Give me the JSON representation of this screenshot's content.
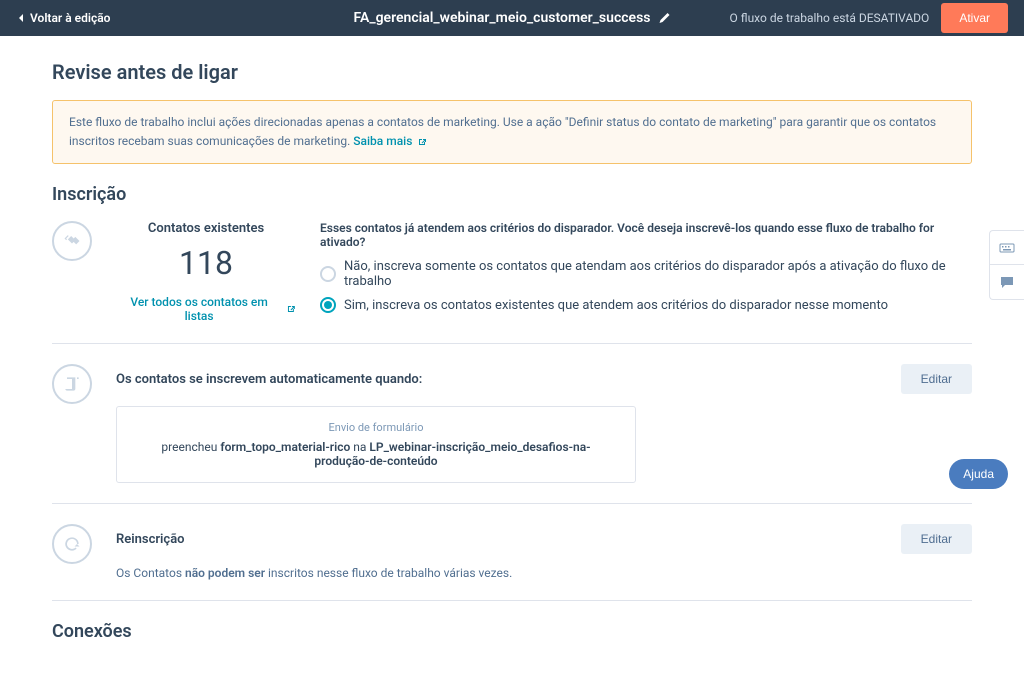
{
  "topbar": {
    "back_label": "Voltar à edição",
    "title": "FA_gerencial_webinar_meio_customer_success",
    "status_text": "O fluxo de trabalho está DESATIVADO",
    "activate_label": "Ativar"
  },
  "page_title": "Revise antes de ligar",
  "notice": {
    "text": "Este fluxo de trabalho inclui ações direcionadas apenas a contatos de marketing. Use a ação \"Definir status do contato de marketing\" para garantir que os contatos inscritos recebam suas comunicações de marketing.",
    "link_label": "Saiba mais"
  },
  "enrollment": {
    "section_title": "Inscrição",
    "existing_label": "Contatos existentes",
    "existing_count": "118",
    "view_all_link": "Ver todos os contatos em listas",
    "question": "Esses contatos já atendem aos critérios do disparador. Você deseja inscrevê-los quando esse fluxo de trabalho for ativado?",
    "option_no": "Não, inscreva somente os contatos que atendam aos critérios do disparador após a ativação do fluxo de trabalho",
    "option_yes": "Sim, inscreva os contatos existentes que atendem aos critérios do disparador nesse momento"
  },
  "auto_enroll": {
    "header": "Os contatos se inscrevem automaticamente quando:",
    "edit_label": "Editar",
    "trigger_title": "Envio de formulário",
    "trigger_prefix": "preencheu ",
    "trigger_form": "form_topo_material-rico",
    "trigger_middle": " na ",
    "trigger_page": "LP_webinar-inscrição_meio_desafios-na-produção-de-conteúdo"
  },
  "reenroll": {
    "header": "Reinscrição",
    "edit_label": "Editar",
    "text_prefix": "Os Contatos ",
    "text_bold": "não podem ser",
    "text_suffix": " inscritos nesse fluxo de trabalho várias vezes."
  },
  "connections_title": "Conexões",
  "help_label": "Ajuda"
}
